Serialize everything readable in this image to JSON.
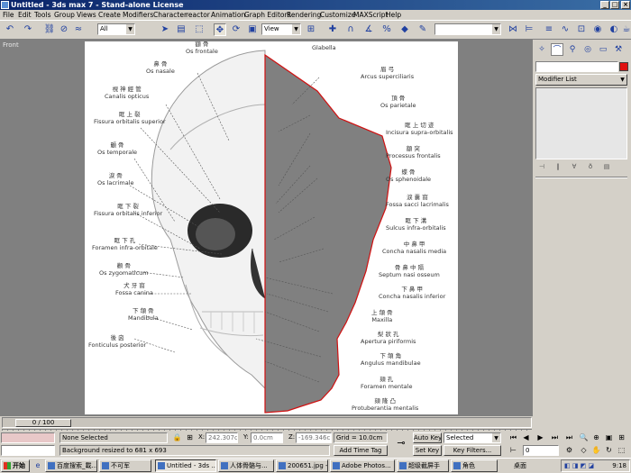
{
  "window": {
    "title": "Untitled - 3ds max 7  - Stand-alone License"
  },
  "menu": [
    "File",
    "Edit",
    "Tools",
    "Group",
    "Views",
    "Create",
    "Modifiers",
    "Character",
    "reactor",
    "Animation",
    "Graph Editors",
    "Rendering",
    "Customize",
    "MAXScript",
    "Help"
  ],
  "toolbar": {
    "selection_filter": "All",
    "ref_coord": "View",
    "named_sel": ""
  },
  "viewport": {
    "label": "Front",
    "labels": [
      {
        "zh": "額 骨",
        "la": "Os frontale"
      },
      {
        "zh": "",
        "la": "Glabella"
      },
      {
        "zh": "鼻 骨",
        "la": "Os nasale"
      },
      {
        "zh": "眉 弓",
        "la": "Arcus superciliaris"
      },
      {
        "zh": "視 神 經 管",
        "la": "Canalis opticus"
      },
      {
        "zh": "頂 骨",
        "la": "Os parietale"
      },
      {
        "zh": "眶 上 裂",
        "la": "Fissura orbitalis superior"
      },
      {
        "zh": "眶 上 切 迹",
        "la": "Incisura supra-orbitalis"
      },
      {
        "zh": "顳 骨",
        "la": "Os temporale"
      },
      {
        "zh": "額 突",
        "la": "Processus frontalis"
      },
      {
        "zh": "淚 骨",
        "la": "Os lacrimale"
      },
      {
        "zh": "蝶 骨",
        "la": "Os sphenoidale"
      },
      {
        "zh": "淚 囊 窩",
        "la": "Fossa sacci lacrimalis"
      },
      {
        "zh": "眶 下 裂",
        "la": "Fissura orbitalis inferior"
      },
      {
        "zh": "眶 下 溝",
        "la": "Sulcus infra-orbitalis"
      },
      {
        "zh": "中 鼻 甲",
        "la": "Concha nasalis media"
      },
      {
        "zh": "眶 下 孔",
        "la": "Foramen infra-orbitale"
      },
      {
        "zh": "骨 鼻 中 隔",
        "la": "Septum nasi osseum"
      },
      {
        "zh": "顴 骨",
        "la": "Os zygomaticum"
      },
      {
        "zh": "下 鼻 甲",
        "la": "Concha nasalis inferior"
      },
      {
        "zh": "犬 牙 窩",
        "la": "Fossa canina"
      },
      {
        "zh": "上 頜 骨",
        "la": "Maxilla"
      },
      {
        "zh": "下 頜 骨",
        "la": "Mandibula"
      },
      {
        "zh": "梨 狀 孔",
        "la": "Apertura piriformis"
      },
      {
        "zh": "後 囟",
        "la": "Fonticulus posterior"
      },
      {
        "zh": "下 頜 角",
        "la": "Angulus mandibulae"
      },
      {
        "zh": "頦 孔",
        "la": "Foramen mentale"
      },
      {
        "zh": "頦 隆 凸",
        "la": "Protuberantia mentalis"
      }
    ]
  },
  "command_panel": {
    "modifier_list": "Modifier List",
    "color": "#e01010"
  },
  "timeline": {
    "frame_label": "0 / 100"
  },
  "status": {
    "selection": "None Selected",
    "prompt": "Background resized to 681 x 693",
    "x_label": "X:",
    "x_value": "242.307cm",
    "y_label": "Y:",
    "y_value": "0.0cm",
    "z_label": "Z:",
    "z_value": "-169.346cm",
    "grid": "Grid = 10.0cm",
    "add_time_tag": "Add Time Tag",
    "auto_key": "Auto Key",
    "set_key": "Set Key",
    "key_mode": "Selected",
    "key_filters": "Key Filters...",
    "frame_value": "0"
  },
  "taskbar": {
    "start": "开始",
    "tasks": [
      "百度搜索_載...",
      "不可军",
      "Untitled - 3ds ...",
      "人体骨骼与...",
      "200651.jpg - ...",
      "Adobe Photos...",
      "超级截屏手",
      "角色"
    ],
    "tray_label": "桌面",
    "time": "9:18"
  }
}
